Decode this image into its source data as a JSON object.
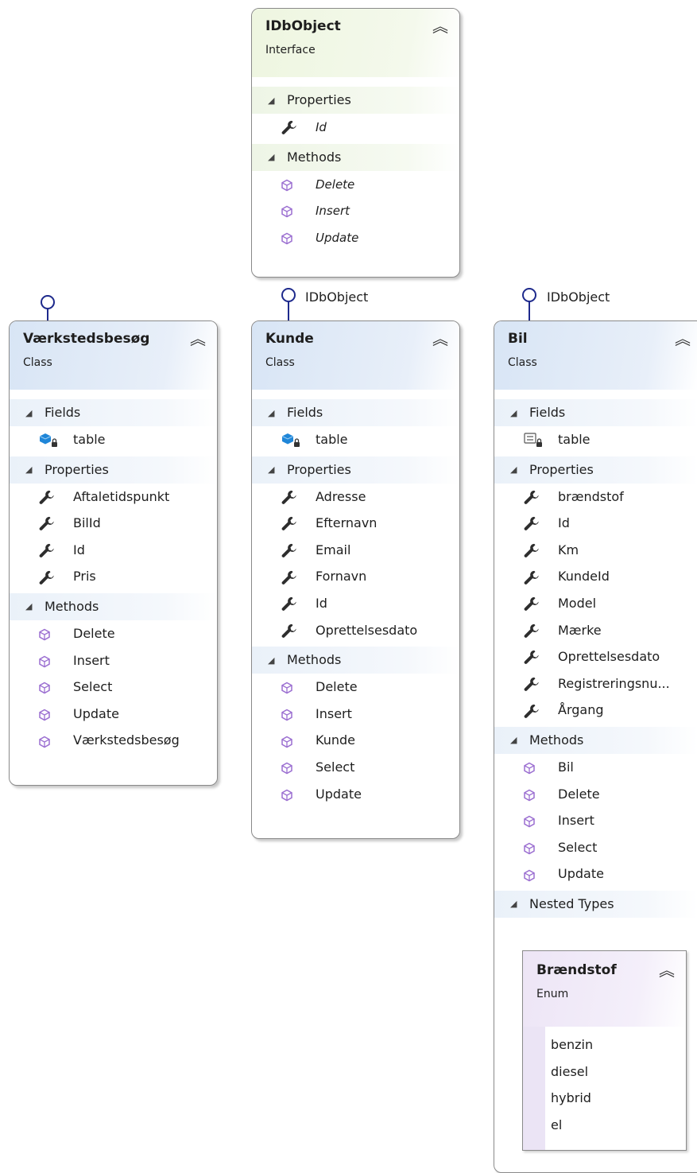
{
  "idbobject": {
    "name": "IDbObject",
    "kind": "Interface",
    "sections": [
      {
        "label": "Properties",
        "items": [
          {
            "icon": "wrench",
            "label": "Id"
          }
        ]
      },
      {
        "label": "Methods",
        "items": [
          {
            "icon": "method",
            "label": "Delete"
          },
          {
            "icon": "method",
            "label": "Insert"
          },
          {
            "icon": "method",
            "label": "Update"
          }
        ]
      }
    ]
  },
  "vaerkstedsbesog": {
    "name": "Værkstedsbesøg",
    "kind": "Class",
    "sections": [
      {
        "label": "Fields",
        "items": [
          {
            "icon": "field",
            "label": "table"
          }
        ]
      },
      {
        "label": "Properties",
        "items": [
          {
            "icon": "wrench",
            "label": "Aftaletidspunkt"
          },
          {
            "icon": "wrench",
            "label": "BilId"
          },
          {
            "icon": "wrench",
            "label": "Id"
          },
          {
            "icon": "wrench",
            "label": "Pris"
          }
        ]
      },
      {
        "label": "Methods",
        "items": [
          {
            "icon": "method",
            "label": "Delete"
          },
          {
            "icon": "method",
            "label": "Insert"
          },
          {
            "icon": "method",
            "label": "Select"
          },
          {
            "icon": "method",
            "label": "Update"
          },
          {
            "icon": "method",
            "label": "Værkstedsbesøg"
          }
        ]
      }
    ]
  },
  "kunde": {
    "name": "Kunde",
    "kind": "Class",
    "interface_label": "IDbObject",
    "sections": [
      {
        "label": "Fields",
        "items": [
          {
            "icon": "field",
            "label": "table"
          }
        ]
      },
      {
        "label": "Properties",
        "items": [
          {
            "icon": "wrench",
            "label": "Adresse"
          },
          {
            "icon": "wrench",
            "label": "Efternavn"
          },
          {
            "icon": "wrench",
            "label": "Email"
          },
          {
            "icon": "wrench",
            "label": "Fornavn"
          },
          {
            "icon": "wrench",
            "label": "Id"
          },
          {
            "icon": "wrench",
            "label": "Oprettelsesdato"
          }
        ]
      },
      {
        "label": "Methods",
        "items": [
          {
            "icon": "method",
            "label": "Delete"
          },
          {
            "icon": "method",
            "label": "Insert"
          },
          {
            "icon": "method",
            "label": "Kunde"
          },
          {
            "icon": "method",
            "label": "Select"
          },
          {
            "icon": "method",
            "label": "Update"
          }
        ]
      }
    ]
  },
  "bil": {
    "name": "Bil",
    "kind": "Class",
    "interface_label": "IDbObject",
    "sections": [
      {
        "label": "Fields",
        "items": [
          {
            "icon": "const-field",
            "label": "table"
          }
        ]
      },
      {
        "label": "Properties",
        "items": [
          {
            "icon": "wrench",
            "label": "brændstof"
          },
          {
            "icon": "wrench",
            "label": "Id"
          },
          {
            "icon": "wrench",
            "label": "Km"
          },
          {
            "icon": "wrench",
            "label": "KundeId"
          },
          {
            "icon": "wrench",
            "label": "Model"
          },
          {
            "icon": "wrench",
            "label": "Mærke"
          },
          {
            "icon": "wrench",
            "label": "Oprettelsesdato"
          },
          {
            "icon": "wrench",
            "label": "Registreringsnu..."
          },
          {
            "icon": "wrench",
            "label": "Årgang"
          }
        ]
      },
      {
        "label": "Methods",
        "items": [
          {
            "icon": "method",
            "label": "Bil"
          },
          {
            "icon": "method",
            "label": "Delete"
          },
          {
            "icon": "method",
            "label": "Insert"
          },
          {
            "icon": "method",
            "label": "Select"
          },
          {
            "icon": "method",
            "label": "Update"
          }
        ]
      },
      {
        "label": "Nested Types",
        "items": []
      }
    ]
  },
  "braendstof": {
    "name": "Brændstof",
    "kind": "Enum",
    "values": [
      "benzin",
      "diesel",
      "hybrid",
      "el"
    ]
  },
  "colors": {
    "class_header": "#dbe6f5",
    "interface_header": "#eef6e0",
    "enum_header": "#ede5f6",
    "lollipop": "#1e2a8c",
    "wrench": "#2d2d2d",
    "method": "#9b6fd1",
    "field": "#1f86d8"
  }
}
